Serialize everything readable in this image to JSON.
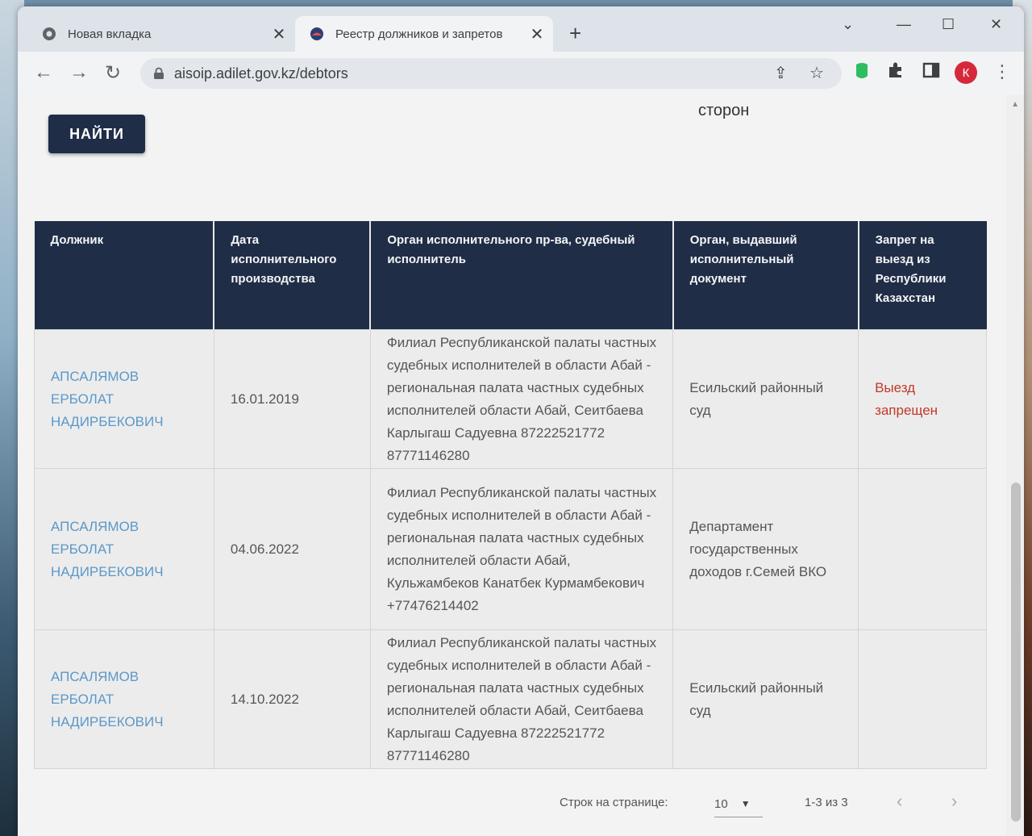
{
  "browser": {
    "tabs": [
      {
        "title": "Новая вкладка",
        "active": false
      },
      {
        "title": "Реестр должников и запретов",
        "active": true
      }
    ],
    "url": "aisoip.adilet.gov.kz/debtors",
    "profile_initial": "К"
  },
  "page": {
    "search_button": "НАЙТИ",
    "partial_label": "сторон",
    "table": {
      "headers": [
        "Должник",
        "Дата исполнительного производства",
        "Орган исполнительного пр-ва, судебный исполнитель",
        "Орган, выдавший исполнительный документ",
        "Запрет на выезд из Республики Казахстан"
      ],
      "rows": [
        {
          "debtor": "АПСАЛЯМОВ ЕРБОЛАТ НАДИРБЕКОВИЧ",
          "date": "16.01.2019",
          "executor": "Филиал Республиканской палаты частных судебных исполнителей в области Абай - региональная палата частных судебных исполнителей области Абай, Сеитбаева Карлыгаш Садуевна 87222521772 87771146280",
          "issuer": "Есильский районный суд",
          "ban": "Выезд запрещен"
        },
        {
          "debtor": "АПСАЛЯМОВ ЕРБОЛАТ НАДИРБЕКОВИЧ",
          "date": "04.06.2022",
          "executor": "Филиал Республиканской палаты частных судебных исполнителей в области Абай - региональная палата частных судебных исполнителей области Абай, Кульжамбеков Канатбек Курмамбекович +77476214402",
          "issuer": "Департамент государственных доходов г.Семей ВКО",
          "ban": ""
        },
        {
          "debtor": "АПСАЛЯМОВ ЕРБОЛАТ НАДИРБЕКОВИЧ",
          "date": "14.10.2022",
          "executor": "Филиал Республиканской палаты частных судебных исполнителей в области Абай - региональная палата частных судебных исполнителей области Абай, Сеитбаева Карлыгаш Садуевна 87222521772 87771146280",
          "issuer": "Есильский районный суд",
          "ban": ""
        }
      ]
    },
    "pagination": {
      "rows_label": "Строк на странице:",
      "rows_value": "10",
      "range": "1-3 из 3"
    }
  },
  "icons": {
    "tab1_favicon": "chrome-icon",
    "tab2_favicon": "adilet-emblem-icon",
    "lock": "lock-icon",
    "share": "share-icon",
    "bookmark": "star-icon",
    "extension1": "evernote-icon",
    "extension2": "puzzle-icon",
    "sidepanel": "side-panel-icon"
  },
  "colors": {
    "header_bg": "#1f2d47",
    "link": "#5b98c9",
    "ban_text": "#c0392b"
  }
}
